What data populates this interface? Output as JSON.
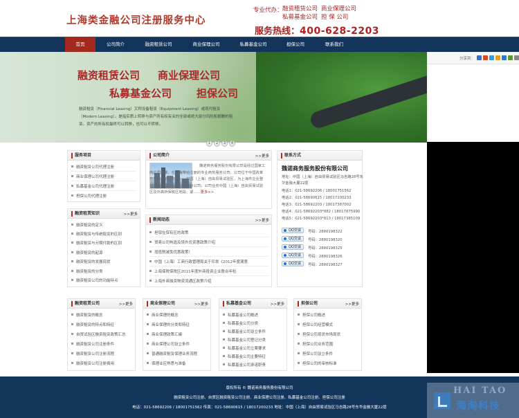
{
  "header": {
    "title": "上海类金融公司注册服务中心",
    "biz_prefix": "专业代办：",
    "biz_items": [
      "融资租赁公司",
      "商业保理公司",
      "私募基金公司",
      "担 保 公司"
    ],
    "hotline_label": "服务热线：",
    "hotline_number": "400-628-2203"
  },
  "nav": {
    "items": [
      "首页",
      "公司简介",
      "融资租赁公司",
      "商业保理公司",
      "私募基金公司",
      "担保公司",
      "联系我们"
    ],
    "active": 0
  },
  "share": {
    "label": "分享到：",
    "icons": [
      "#3a6ec4",
      "#d64a2a",
      "#3a9ad8",
      "#e0a02a",
      "#2a7ac8",
      "#5a9a3a",
      "#888888"
    ]
  },
  "banner": {
    "line1": [
      "融资租赁公司",
      "商业保理公司"
    ],
    "line2": [
      "私募基金公司",
      "担保公司"
    ],
    "desc": "融资租赁（Financial Leasing）又称设备租赁（Equipment Leasing）或现代租赁（Modern Leasing），是指实质上转移与资产所有权有关的全部或绝大部分风险和报酬的租赁。资产的所有权最终可以转移，也可以不转移。",
    "dots": [
      "1",
      "2",
      "3",
      "4"
    ]
  },
  "services": {
    "title": "服务项目",
    "items": [
      "融资租赁公司代理注册",
      "商业保理公司代理注册",
      "私募基金公司代理注册",
      "担保公司代理注册"
    ]
  },
  "knowledge": {
    "title": "融资租赁知识",
    "more": ">>更多",
    "items": [
      "融资租赁的定义",
      "融资租赁与传统租赁的区别",
      "融资租赁与分期付款的区别",
      "融资租赁的起源",
      "融资租赁的发展现状",
      "融资租赁的分类",
      "融资租赁公司的功能特点"
    ]
  },
  "intro": {
    "title": "公司简介",
    "more": ">>更多",
    "text": "魏诺商务服务股份有限公司是经过国家工商总局批准，在上海带给注册的专业商务服务公司，公司位于中国改革开放的最前沿阵地——中国（上海）自由贸易试验区，为上海市企业登记注册代理行业第一家股份公司，公司业务中国（上海）自由贸易试验区及外高桥保税区地段、紧......",
    "more_link": "更多>>"
  },
  "news": {
    "title": "新闻动态",
    "more": ">>更多",
    "items": [
      "担保在保有区的政策",
      "贸易公司构造及境外优资惠政策介绍",
      "增值税减免优惠政策！",
      "中国（上海）工商行政管理局关于印发《2012年度满意",
      "上海保税保税区2011年度外商投资企业联合年检",
      "上海外商独资物资流通区政策介绍"
    ]
  },
  "contact": {
    "title": "联系方式",
    "company": "魏诺商务服务股份有限公司",
    "address": "地址：中国（上海）自由贸易试验区马吉路28号东",
    "address2": "华金融大厦22层",
    "phones": [
      "电话1：021-58692206 / 18001751562",
      "电话2：021-58690615 / 18017200233",
      "电话3：021-58692203 / 18017387002",
      "电话4：021-58692203*882 / 18017875990",
      "电话5：021-58692203*813 / 18017385109"
    ],
    "qq_label": "QQ交谈",
    "qq_numbers": [
      "号码：2880198322",
      "号码：2880198320",
      "号码：2880198325",
      "号码：2880198326",
      "号码：2880198327"
    ]
  },
  "columns": [
    {
      "title": "融资租赁公司",
      "more": ">>更多",
      "items": [
        "融资租赁的概念",
        "融资租赁的特点和特征",
        "自贸试验区融资租赁政策汇总",
        "融资租赁公司注册条件",
        "融资租赁公司注册流程",
        "融资租赁公司注册费用"
      ]
    },
    {
      "title": "商业保理公司",
      "more": ">>更多",
      "items": [
        "商业保理的概念",
        "商业保理的分类和特征",
        "商业保理政策汇编",
        "商业保理公司设立条件",
        "普通融资租赁保理业务流程",
        "保理业应熟悉与准备"
      ]
    },
    {
      "title": "私募基金公司",
      "more": ">>更多",
      "items": [
        "私募基金公司概述",
        "私募基金公司分类",
        "私募基金公司设立条件",
        "私募基金公司登记分类",
        "私募基金公司立案要求",
        "私募基金公司主要特征",
        "私募基金公司承诺职责"
      ]
    },
    {
      "title": "担保公司",
      "more": ">>更多",
      "items": [
        "担保公司概述",
        "担保公司经营模式",
        "担保公司现状市场现状",
        "担保公司业务范围",
        "担保公司设立条件",
        "担保公司的审核标准"
      ]
    }
  ],
  "footer": {
    "copyright": "版权所有 © 魏诺商务服务股份有限公司",
    "links": "融资租赁公司注册、自贸区融资租赁公司注册、商业保理公司注册、私募基金公司注册、担保公司注册",
    "contact": "电话：021-58692206 / 18001751562 传真：021-58690615 / 18017200233 地址：中国（上海）自由贸易试验区马吉路28号东华金融大厦22层"
  },
  "watermark": {
    "en": "HAI TAO",
    "cn": "海淘科技"
  }
}
